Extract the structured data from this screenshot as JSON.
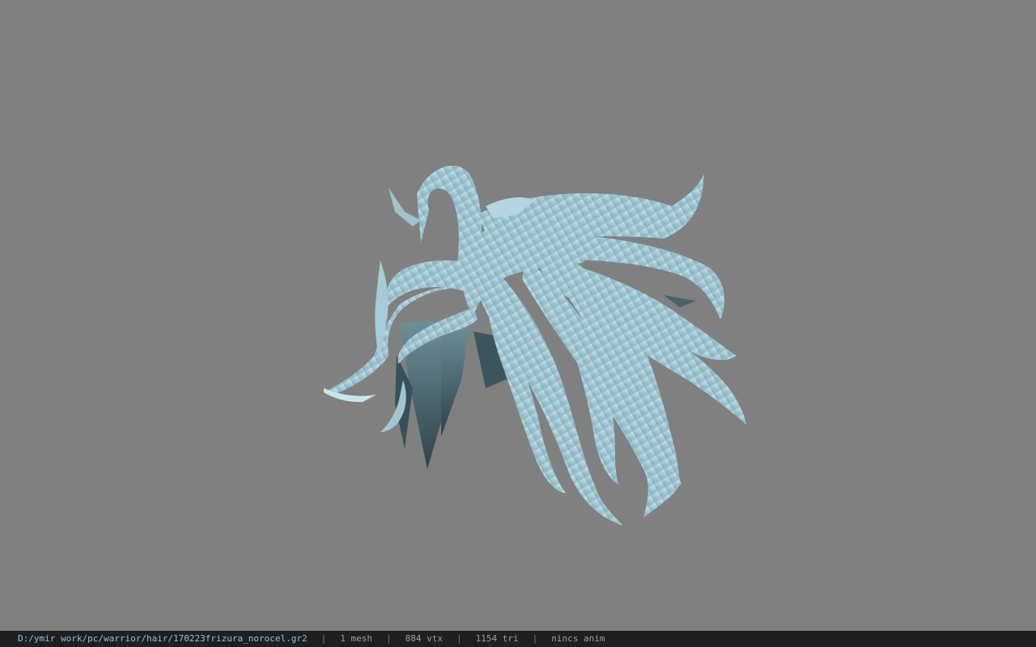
{
  "viewport": {
    "background_color": "#808080",
    "model_color_light": "#bfe0ea",
    "model_color_mid": "#8fb9c6",
    "model_color_dark": "#3f5a63"
  },
  "status_bar": {
    "file_path": "D:/ymir work/pc/warrior/hair/170223frizura_norocel.gr2",
    "mesh_count": "1 mesh",
    "vertex_count": "884 vtx",
    "triangle_count": "1154 tri",
    "animation": "nincs anim",
    "separator": "|"
  }
}
